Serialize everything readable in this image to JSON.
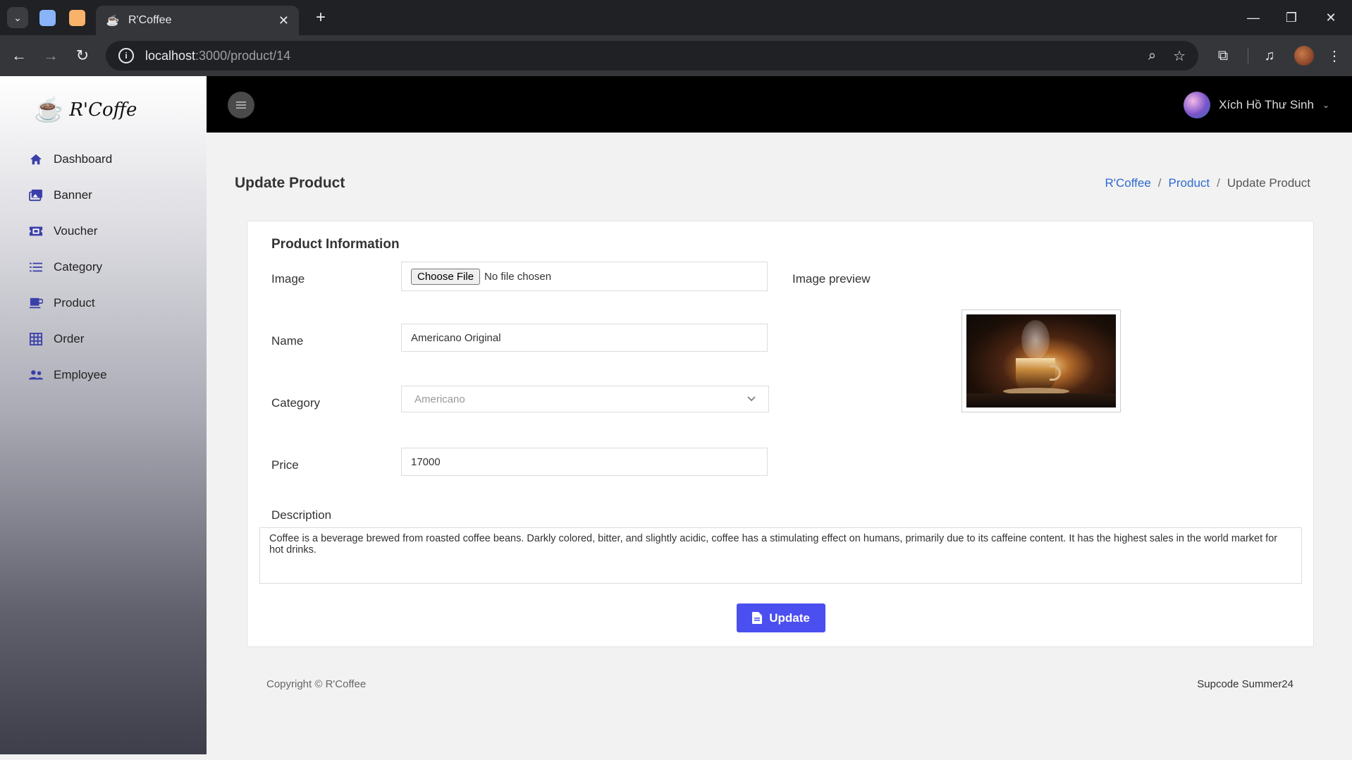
{
  "browser": {
    "tab_title": "R'Coffee",
    "url_host": "localhost",
    "url_path": ":3000/product/14",
    "window_controls": [
      "minimize",
      "restore",
      "close"
    ]
  },
  "sidebar": {
    "logo_text": "R'Coffe",
    "items": [
      {
        "label": "Dashboard",
        "icon": "home-icon"
      },
      {
        "label": "Banner",
        "icon": "images-icon"
      },
      {
        "label": "Voucher",
        "icon": "ticket-icon"
      },
      {
        "label": "Category",
        "icon": "list-icon"
      },
      {
        "label": "Product",
        "icon": "mug-icon"
      },
      {
        "label": "Order",
        "icon": "table-icon"
      },
      {
        "label": "Employee",
        "icon": "users-icon"
      }
    ],
    "icon_color": "#3b3fa8"
  },
  "header": {
    "user_name": "Xích Hồ Thư Sinh"
  },
  "page": {
    "title": "Update Product",
    "breadcrumb": [
      "R'Coffee",
      "Product",
      "Update Product"
    ]
  },
  "form": {
    "section_title": "Product Information",
    "image_label": "Image",
    "file_button": "Choose File",
    "file_status": "No file chosen",
    "preview_label": "Image preview",
    "name_label": "Name",
    "name_value": "Americano Original",
    "category_label": "Category",
    "category_value": "Americano",
    "price_label": "Price",
    "price_value": "17000",
    "description_label": "Description",
    "description_value": "Coffee is a beverage brewed from roasted coffee beans. Darkly colored, bitter, and slightly acidic, coffee has a stimulating effect on humans, primarily due to its caffeine content. It has the highest sales in the world market for hot drinks.",
    "submit_label": "Update",
    "submit_color": "#4b4ff0"
  },
  "footer": {
    "copyright": "Copyright © R'Coffee",
    "credit": "Supcode Summer24"
  }
}
